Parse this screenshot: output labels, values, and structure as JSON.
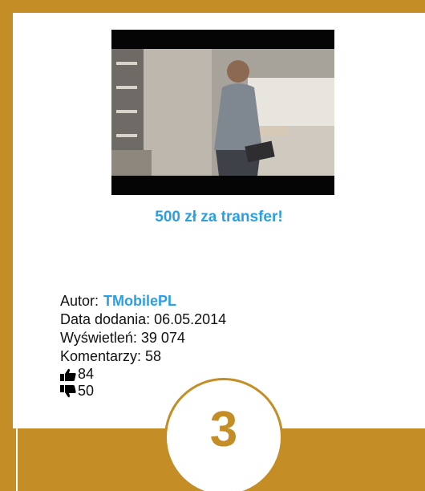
{
  "video": {
    "title": "500 zł za transfer!",
    "thumbnail_icon": "video-thumbnail"
  },
  "meta": {
    "author_label": "Autor:",
    "author_name": "TMobilePL",
    "date_label": "Data dodania: 06.05.2014",
    "views_label": "Wyświetleń: 39 074",
    "comments_label": "Komentarzy: 58",
    "likes": "84",
    "dislikes": "50"
  },
  "rank": "3",
  "colors": {
    "frame": "#C48D25",
    "link": "#2B9FE3",
    "card": "#FFFFFF"
  }
}
